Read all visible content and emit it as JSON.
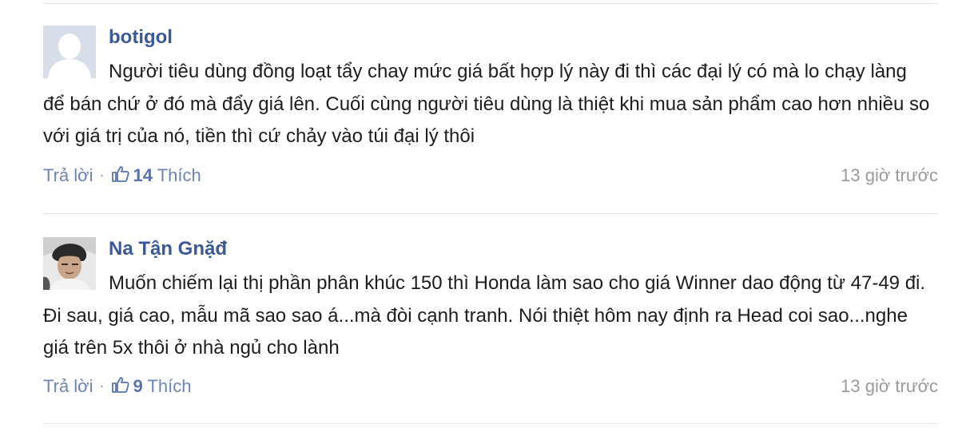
{
  "comments": [
    {
      "author": "botigol",
      "avatar": "default-silhouette-avatar",
      "text": "Người tiêu dùng đồng loạt tẩy chay mức giá bất hợp lý này đi thì các đại lý có mà lo chạy làng để bán chứ ở đó mà đẩy giá lên. Cuối cùng người tiêu dùng là thiệt khi mua sản phẩm cao hơn nhiều so với giá trị của nó, tiền thì cứ chảy vào túi đại lý thôi",
      "reply_label": "Trả lời",
      "separator": "·",
      "like_count": "14",
      "like_label": "Thích",
      "timestamp": "13 giờ trước"
    },
    {
      "author": "Na Tận Gnặđ",
      "avatar": "user-photo-avatar",
      "text": "Muốn chiếm lại thị phần phân khúc 150 thì Honda làm sao cho giá Winner dao động từ 47-49 đi. Đi sau, giá cao, mẫu mã sao sao á...mà đòi cạnh tranh. Nói thiệt hôm nay định ra Head coi sao...nghe giá trên 5x thôi ở nhà ngủ cho lành",
      "reply_label": "Trả lời",
      "separator": "·",
      "like_count": "9",
      "like_label": "Thích",
      "timestamp": "13 giờ trước"
    }
  ],
  "colors": {
    "author": "#3b5998",
    "action_link": "#6d84b4",
    "timestamp": "#9a9a9a",
    "divider": "#e3e5e9",
    "body_text": "#1d1d1d"
  }
}
